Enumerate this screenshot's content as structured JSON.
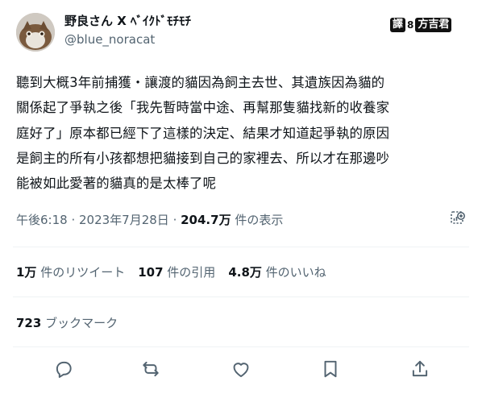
{
  "author": {
    "display_name": "野良さん X ﾍﾞｲｸﾄﾞﾓﾁﾓﾁ",
    "handle": "@blue_noracat",
    "badge": {
      "box1": "譯",
      "dots": "8",
      "box2": "方吉君"
    }
  },
  "tweet": {
    "lines": [
      "聽到大概3年前捕獲・讓渡的貓因為飼主去世、其遺族因為貓的",
      "關係起了爭執之後「我先暫時當中途、再幫那隻貓找新的收養家",
      "庭好了」原本都已經下了這樣的決定、結果才知道起爭執的原因",
      "是飼主的所有小孩都想把貓接到自己的家裡去、所以才在那邊吵",
      "能被如此愛著的貓真的是太棒了呢"
    ]
  },
  "meta": {
    "time": "午後6:18",
    "sep1": " · ",
    "date": "2023年7月28日",
    "sep2": " · ",
    "views_count": "204.7万",
    "views_label": " 件の表示"
  },
  "stats": {
    "retweets_count": "1万",
    "retweets_label": " 件のリツイート",
    "quotes_count": "107",
    "quotes_label": " 件の引用",
    "likes_count": "4.8万",
    "likes_label": " 件のいいね"
  },
  "bookmarks": {
    "count": "723",
    "label": " ブックマーク"
  },
  "icons": {
    "views": "analytics-icon",
    "reply": "reply-icon",
    "retweet": "retweet-icon",
    "like": "heart-icon",
    "bookmark": "bookmark-icon",
    "share": "share-icon"
  },
  "colors": {
    "text": "#0f1419",
    "secondary": "#536471",
    "divider": "#eff3f4"
  }
}
